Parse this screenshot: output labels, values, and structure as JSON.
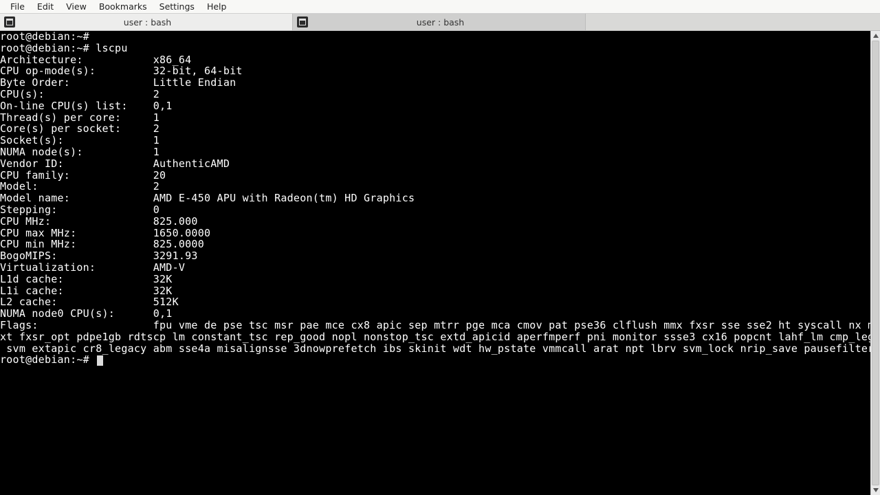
{
  "menu": {
    "items": [
      "File",
      "Edit",
      "View",
      "Bookmarks",
      "Settings",
      "Help"
    ]
  },
  "tabs": [
    {
      "title": "user : bash",
      "active": true
    },
    {
      "title": "user : bash",
      "active": false
    }
  ],
  "prompt": "root@debian:~#",
  "command": "lscpu",
  "lscpu": {
    "label_width": 24,
    "rows": [
      {
        "label": "Architecture:",
        "value": "x86_64"
      },
      {
        "label": "CPU op-mode(s):",
        "value": "32-bit, 64-bit"
      },
      {
        "label": "Byte Order:",
        "value": "Little Endian"
      },
      {
        "label": "CPU(s):",
        "value": "2"
      },
      {
        "label": "On-line CPU(s) list:",
        "value": "0,1"
      },
      {
        "label": "Thread(s) per core:",
        "value": "1"
      },
      {
        "label": "Core(s) per socket:",
        "value": "2"
      },
      {
        "label": "Socket(s):",
        "value": "1"
      },
      {
        "label": "NUMA node(s):",
        "value": "1"
      },
      {
        "label": "Vendor ID:",
        "value": "AuthenticAMD"
      },
      {
        "label": "CPU family:",
        "value": "20"
      },
      {
        "label": "Model:",
        "value": "2"
      },
      {
        "label": "Model name:",
        "value": "AMD E-450 APU with Radeon(tm) HD Graphics"
      },
      {
        "label": "Stepping:",
        "value": "0"
      },
      {
        "label": "CPU MHz:",
        "value": "825.000"
      },
      {
        "label": "CPU max MHz:",
        "value": "1650.0000"
      },
      {
        "label": "CPU min MHz:",
        "value": "825.0000"
      },
      {
        "label": "BogoMIPS:",
        "value": "3291.93"
      },
      {
        "label": "Virtualization:",
        "value": "AMD-V"
      },
      {
        "label": "L1d cache:",
        "value": "32K"
      },
      {
        "label": "L1i cache:",
        "value": "32K"
      },
      {
        "label": "L2 cache:",
        "value": "512K"
      },
      {
        "label": "NUMA node0 CPU(s):",
        "value": "0,1"
      }
    ],
    "flags_label": "Flags:",
    "flags": "fpu vme de pse tsc msr pae mce cx8 apic sep mtrr pge mca cmov pat pse36 clflush mmx fxsr sse sse2 ht syscall nx mmxext fxsr_opt pdpe1gb rdtscp lm constant_tsc rep_good nopl nonstop_tsc extd_apicid aperfmperf pni monitor ssse3 cx16 popcnt lahf_lm cmp_legacy svm extapic cr8_legacy abm sse4a misalignsse 3dnowprefetch ibs skinit wdt hw_pstate vmmcall arat npt lbrv svm_lock nrip_save pausefilter"
  },
  "terminal_cols": 140
}
